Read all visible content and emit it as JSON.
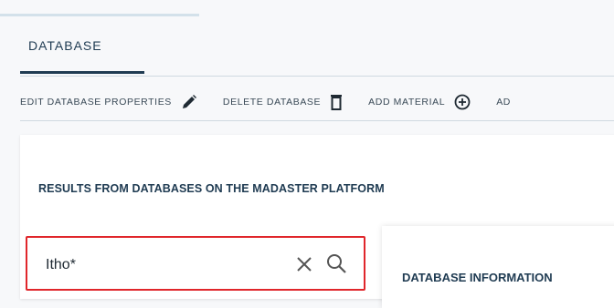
{
  "tab": {
    "label": "DATABASE"
  },
  "toolbar": {
    "edit_label": "EDIT DATABASE PROPERTIES",
    "delete_label": "DELETE DATABASE",
    "add_material_label": "ADD MATERIAL",
    "overflow_label": "AD"
  },
  "results": {
    "title": "RESULTS FROM DATABASES ON THE MADASTER PLATFORM"
  },
  "search": {
    "value": "Itho*"
  },
  "info": {
    "title": "DATABASE INFORMATION"
  },
  "colors": {
    "accent": "#1f3b52",
    "error_border": "#e0262b"
  },
  "icons": [
    "pencil-icon",
    "trash-icon",
    "add-circle-icon",
    "close-icon",
    "search-icon"
  ]
}
